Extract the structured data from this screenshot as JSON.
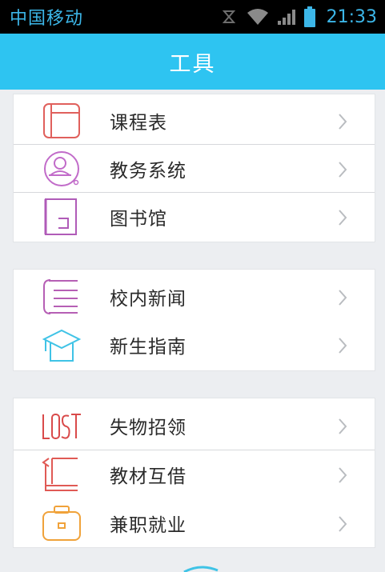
{
  "status_bar": {
    "carrier": "中国移动",
    "time": "21:33",
    "icons": [
      "sync-icon",
      "wifi-icon",
      "signal-icon",
      "battery-icon"
    ]
  },
  "app_bar": {
    "title": "工具",
    "color": "#2ec4f1"
  },
  "groups": [
    {
      "items": [
        {
          "label": "课程表",
          "icon": "timetable-icon",
          "color": "#e0605c"
        },
        {
          "label": "教务系统",
          "icon": "academic-affairs-icon",
          "color": "#c16bc9"
        },
        {
          "label": "图书馆",
          "icon": "library-icon",
          "color": "#b05bb8"
        }
      ]
    },
    {
      "items": [
        {
          "label": "校内新闻",
          "icon": "news-icon",
          "color": "#b65fb5"
        },
        {
          "label": "新生指南",
          "icon": "graduation-cap-icon",
          "color": "#3fc3e6"
        }
      ]
    },
    {
      "items": [
        {
          "label": "失物招领",
          "icon": "lost-found-icon",
          "color": "#d94a4a"
        },
        {
          "label": "教材互借",
          "icon": "textbook-exchange-icon",
          "color": "#e05a55"
        },
        {
          "label": "兼职就业",
          "icon": "briefcase-icon",
          "color": "#f0a23a"
        }
      ]
    }
  ]
}
